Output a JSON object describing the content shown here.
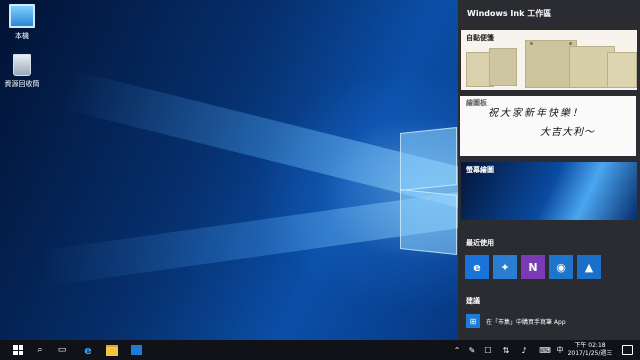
{
  "desktop": {
    "icons": [
      {
        "label": "本機",
        "icon": "computer-icon"
      },
      {
        "label": "資源回收筒",
        "icon": "recycle-bin-icon"
      }
    ]
  },
  "ink_panel": {
    "title": "Windows Ink 工作區",
    "sticky_notes_label": "自黏便箋",
    "sketchpad_label": "繪圖板",
    "sketch_text_line1": "祝大家新年快樂！",
    "sketch_text_line2": "大吉大利～",
    "screen_sketch_label": "螢幕繪圖",
    "recent_label": "最近使用",
    "recent_apps": [
      {
        "name": "Microsoft Edge",
        "icon": "edge-icon",
        "color": "#1a73d9"
      },
      {
        "name": "地圖",
        "icon": "maps-icon",
        "color": "#2a7dd1"
      },
      {
        "name": "OneNote",
        "icon": "onenote-icon",
        "color": "#7a3ab5"
      },
      {
        "name": "相機",
        "icon": "camera-icon",
        "color": "#1f74cc"
      },
      {
        "name": "相片",
        "icon": "photos-icon",
        "color": "#1a6fc8"
      }
    ],
    "suggestions_label": "建議",
    "suggestion_text": "在「市集」中購買手寫筆 App"
  },
  "taskbar": {
    "ime_indicator": "中",
    "time": "下午 02:18",
    "date": "2017/1/25/週三"
  },
  "colors": {
    "panel_bg": "#2a2c31",
    "taskbar_bg": "#101218",
    "accent": "#1a73d9"
  }
}
